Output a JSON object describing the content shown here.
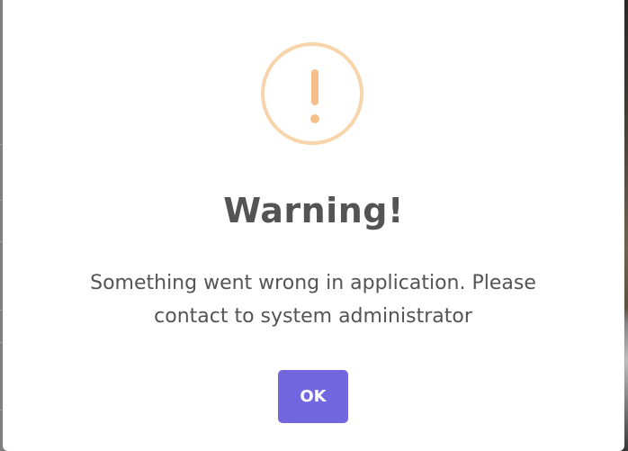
{
  "dialog": {
    "icon": "warning-exclamation-icon",
    "title": "Warning!",
    "message": "Something went wrong in application. Please contact to system administrator",
    "ok_label": "OK"
  },
  "colors": {
    "icon_ring": "#f8d4ab",
    "icon_mark": "#f6be88",
    "title_text": "#545454",
    "button_bg": "#7367e0",
    "button_text": "#ffffff"
  }
}
